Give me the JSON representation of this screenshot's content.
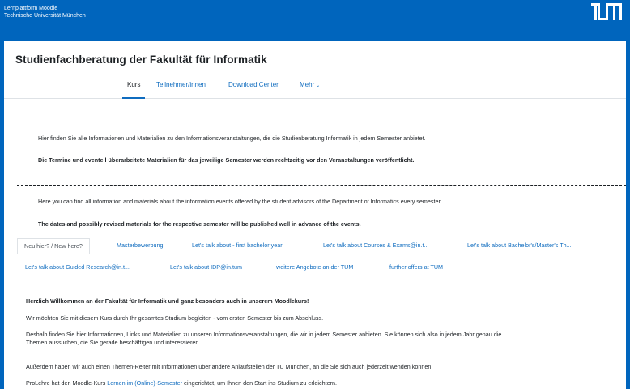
{
  "header": {
    "brand_line1": "Lernplattform Moodle",
    "brand_line2": "Technische Universität München",
    "logo_text": "TUM",
    "bar_color": "#0065bd"
  },
  "course": {
    "title": "Studienfachberatung der Fakultät für Informatik"
  },
  "nav": {
    "items": [
      "Kurs",
      "Teilnehmer/innen",
      "Download Center",
      "Mehr"
    ],
    "active": "Kurs",
    "more_chevron": "⌄"
  },
  "intro": {
    "de_text": "Hier finden Sie alle Informationen und Materialien zu den Informationsveranstaltungen, die die Studienberatung Informatik in jedem Semester anbietet.",
    "de_bold": "Die Termine und eventell überarbeitete Materialien für das jeweilige Semester werden rechtzeitig vor den Veranstaltungen veröffentlicht.",
    "en_text": "Here you can find all information and materials about the information events offered by the student advisors of the Department of Informatics every semester.",
    "en_bold": "The dates and possibly revised materials for the respective semester will be published well in advance of the events."
  },
  "tabs": {
    "row1": [
      "Neu hier? / New here?",
      "Masterbewerbung",
      "Let's talk about - first bachelor year",
      "Let's talk about Courses & Exams@in.t...",
      "Let's talk about Bachelor's/Master's Th..."
    ],
    "row2": [
      "Let's talk about Guided Research@in.t...",
      "Let's talk about IDP@in.tum",
      "weitere Angebote an der TUM",
      "further offers at TUM"
    ],
    "active": "Neu hier? / New here?"
  },
  "content": {
    "welcome": "Herzlich Willkommen an der Fakultät für Informatik und ganz besonders auch in unserem Moodlekurs!",
    "p1": "Wir möchten Sie mit diesem Kurs durch Ihr gesamtes Studium begleiten - vom ersten Semester bis zum Abschluss.",
    "p2_line1": "Deshalb finden Sie hier Informationen, Links und Materialien zu unseren Informationsveranstaltungen, die wir in jedem Semester anbieten. Sie können sich also in jedem Jahr genau die",
    "p2_line2": "Themen aussuchen, die Sie gerade beschäftigen und interessieren.",
    "p3": "Außerdem haben wir auch einen Themen-Reiter mit Informationen über andere Anlaufstellen der TU München, an die Sie sich auch jederzeit wenden können.",
    "p4_before": "ProLehre hat den Moodle-Kurs ",
    "p4_link": "Lernen im (Online)-Semester",
    "p4_after": " eingerichtet, um Ihnen den Start ins Studium zu erleichtern."
  }
}
